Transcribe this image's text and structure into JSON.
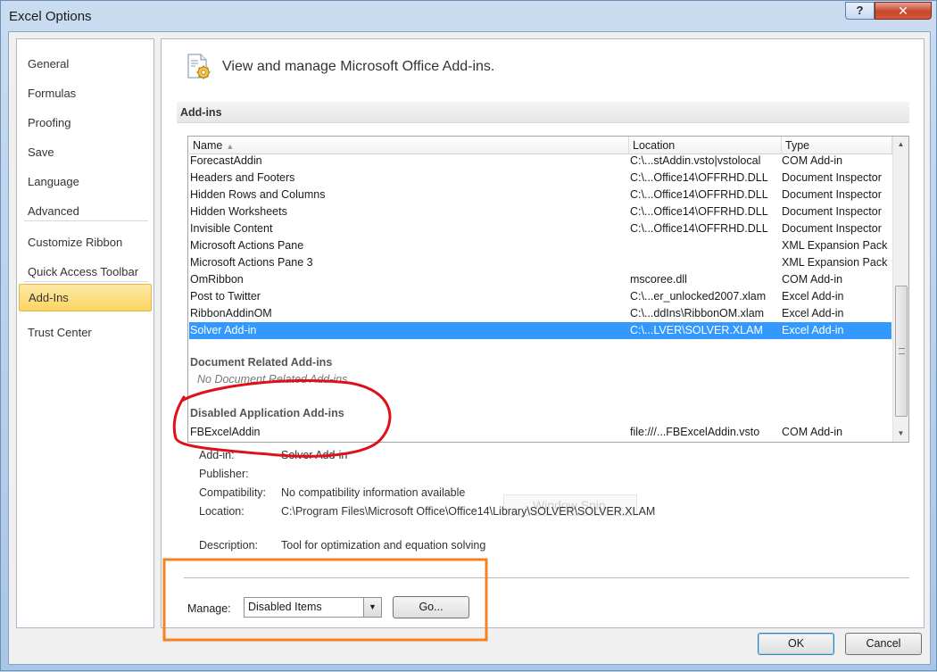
{
  "window": {
    "title": "Excel Options",
    "help_label": "?",
    "close_label": "✕"
  },
  "sidebar": {
    "items": [
      {
        "label": "General"
      },
      {
        "label": "Formulas"
      },
      {
        "label": "Proofing"
      },
      {
        "label": "Save"
      },
      {
        "label": "Language"
      },
      {
        "label": "Advanced"
      },
      {
        "label": "Customize Ribbon"
      },
      {
        "label": "Quick Access Toolbar"
      },
      {
        "label": "Add-Ins"
      },
      {
        "label": "Trust Center"
      }
    ],
    "active": "Add-Ins"
  },
  "header": {
    "text": "View and manage Microsoft Office Add-ins."
  },
  "addins": {
    "section_title": "Add-ins",
    "columns": {
      "name": "Name",
      "location": "Location",
      "type": "Type"
    },
    "rows": [
      {
        "name": "ForecastAddin",
        "location": "C:\\...stAddin.vsto|vstolocal",
        "type": "COM Add-in"
      },
      {
        "name": "Headers and Footers",
        "location": "C:\\...Office14\\OFFRHD.DLL",
        "type": "Document Inspector"
      },
      {
        "name": "Hidden Rows and Columns",
        "location": "C:\\...Office14\\OFFRHD.DLL",
        "type": "Document Inspector"
      },
      {
        "name": "Hidden Worksheets",
        "location": "C:\\...Office14\\OFFRHD.DLL",
        "type": "Document Inspector"
      },
      {
        "name": "Invisible Content",
        "location": "C:\\...Office14\\OFFRHD.DLL",
        "type": "Document Inspector"
      },
      {
        "name": "Microsoft Actions Pane",
        "location": "",
        "type": "XML Expansion Pack"
      },
      {
        "name": "Microsoft Actions Pane 3",
        "location": "",
        "type": "XML Expansion Pack"
      },
      {
        "name": "OmRibbon",
        "location": "mscoree.dll",
        "type": "COM Add-in"
      },
      {
        "name": "Post to Twitter",
        "location": "C:\\...er_unlocked2007.xlam",
        "type": "Excel Add-in"
      },
      {
        "name": "RibbonAddinOM",
        "location": "C:\\...ddIns\\RibbonOM.xlam",
        "type": "Excel Add-in"
      },
      {
        "name": "Solver Add-in",
        "location": "C:\\...LVER\\SOLVER.XLAM",
        "type": "Excel Add-in",
        "selected": true
      }
    ],
    "doc_group_title": "Document Related Add-ins",
    "doc_group_empty": "No Document Related Add-ins",
    "disabled_group_title": "Disabled Application Add-ins",
    "disabled_rows": [
      {
        "name": "FBExcelAddin",
        "location": "file:///...FBExcelAddin.vsto",
        "type": "COM Add-in"
      }
    ],
    "overlay_text": "Window Snip"
  },
  "details": {
    "addin_label": "Add-in:",
    "addin_value": "Solver Add-in",
    "publisher_label": "Publisher:",
    "publisher_value": "",
    "compat_label": "Compatibility:",
    "compat_value": "No compatibility information available",
    "location_label": "Location:",
    "location_value": "C:\\Program Files\\Microsoft Office\\Office14\\Library\\SOLVER\\SOLVER.XLAM",
    "desc_label": "Description:",
    "desc_value": "Tool for optimization and equation solving"
  },
  "manage": {
    "label": "Manage:",
    "selected": "Disabled Items",
    "go_label": "Go..."
  },
  "footer": {
    "ok_label": "OK",
    "cancel_label": "Cancel"
  },
  "colors": {
    "selection": "#3399ff",
    "nav_active": "#fbd560",
    "annotation_red": "#e0101a",
    "annotation_orange": "#f5821f"
  },
  "icons": [
    "addins-gear-icon",
    "sort-ascending-icon",
    "scroll-up-icon",
    "scroll-down-icon",
    "dropdown-arrow-icon"
  ]
}
